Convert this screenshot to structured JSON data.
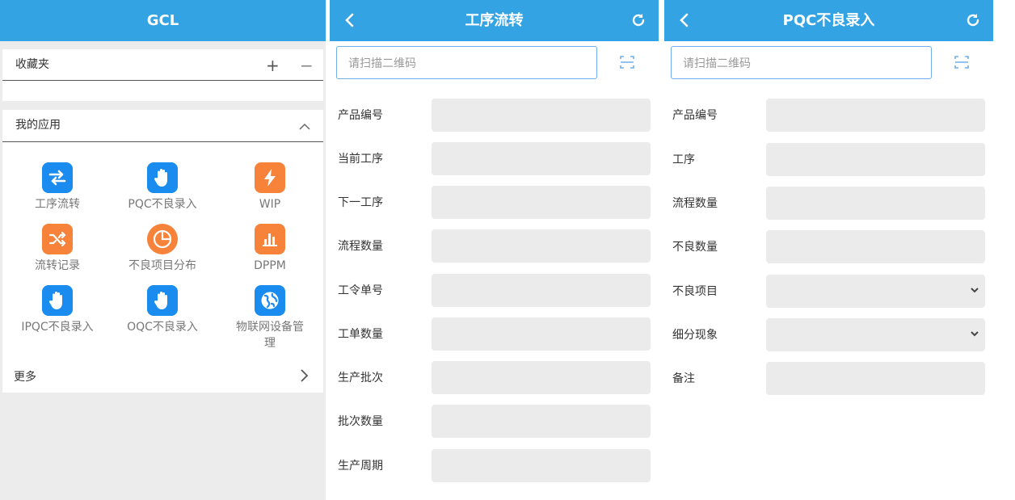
{
  "panel1": {
    "header_title": "GCL",
    "favorites": {
      "title": "收藏夹",
      "add": "+",
      "remove": "−"
    },
    "apps": {
      "title": "我的应用",
      "items": [
        {
          "label": "工序流转",
          "icon": "swap-icon",
          "color": "#1a8cf0"
        },
        {
          "label": "PQC不良录入",
          "icon": "hand-icon",
          "color": "#1a8cf0"
        },
        {
          "label": "WIP",
          "icon": "bolt-icon",
          "color": "#f7823a"
        },
        {
          "label": "流转记录",
          "icon": "shuffle-icon",
          "color": "#f7823a"
        },
        {
          "label": "不良项目分布",
          "icon": "pie-icon",
          "color": "#f7823a"
        },
        {
          "label": "DPPM",
          "icon": "bar-chart-icon",
          "color": "#f7823a"
        },
        {
          "label": "IPQC不良录入",
          "icon": "hand-icon",
          "color": "#1a8cf0"
        },
        {
          "label": "OQC不良录入",
          "icon": "hand-icon",
          "color": "#1a8cf0"
        },
        {
          "label": "物联网设备管理",
          "icon": "globe-icon",
          "color": "#1a8cf0"
        }
      ],
      "more": "更多"
    }
  },
  "panel2": {
    "header_title": "工序流转",
    "scan_placeholder": "请扫描二维码",
    "fields": [
      "产品编号",
      "当前工序",
      "下一工序",
      "流程数量",
      "工令单号",
      "工单数量",
      "生产批次",
      "批次数量",
      "生产周期"
    ]
  },
  "panel3": {
    "header_title": "PQC不良录入",
    "scan_placeholder": "请扫描二维码",
    "fields": [
      "产品编号",
      "工序",
      "流程数量",
      "不良数量",
      "不良项目",
      "细分现象",
      "备注"
    ]
  },
  "colors": {
    "header": "#33a3e4",
    "blue_icon": "#1a8cf0",
    "orange_icon": "#f7823a",
    "field_bg": "#ebebeb"
  }
}
